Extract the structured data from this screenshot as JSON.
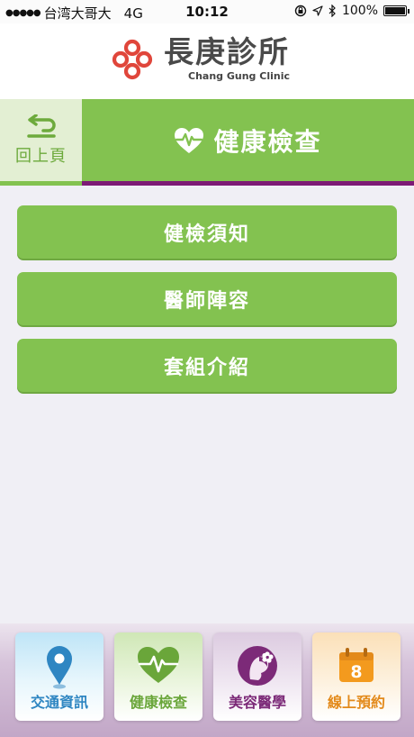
{
  "status_bar": {
    "signal": "●●●●●",
    "carrier": "台湾大哥大",
    "network": "4G",
    "time": "10:12",
    "battery": "100%",
    "battery_level": 1.0
  },
  "header": {
    "logo_cn": "長庚診所",
    "logo_en": "Chang Gung Clinic"
  },
  "titlebar": {
    "back_label": "回上頁",
    "title": "健康檢查"
  },
  "menu": {
    "items": [
      {
        "label": "健檢須知"
      },
      {
        "label": "醫師陣容"
      },
      {
        "label": "套組介紹"
      }
    ]
  },
  "tabbar": {
    "tabs": [
      {
        "label": "交通資訊",
        "icon": "location-pin-icon"
      },
      {
        "label": "健康檢查",
        "icon": "heart-pulse-icon"
      },
      {
        "label": "美容醫學",
        "icon": "woman-flower-icon"
      },
      {
        "label": "線上預約",
        "icon": "calendar-icon",
        "icon_text": "8"
      }
    ]
  },
  "colors": {
    "green": "#83c250",
    "purple": "#7d1a75",
    "logo_red": "#e0463b",
    "blue": "#2f86c2",
    "orange": "#e38a1b"
  }
}
